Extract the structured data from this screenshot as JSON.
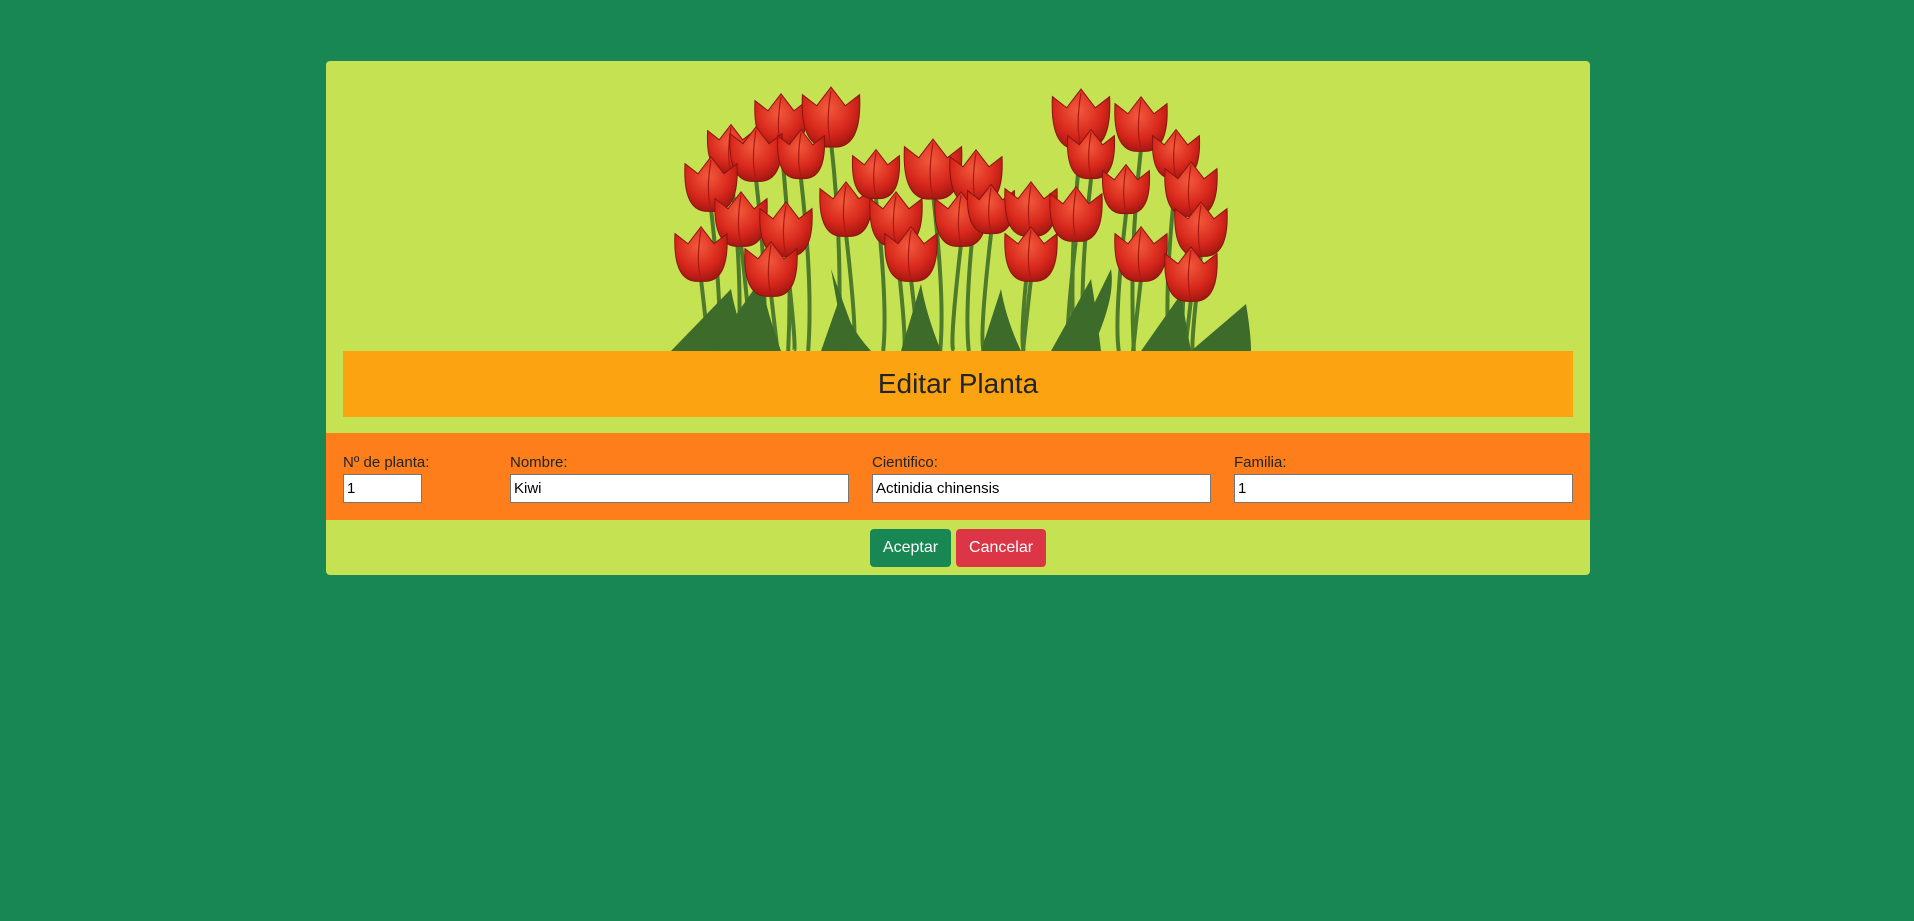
{
  "page": {
    "background_color": "#198754"
  },
  "card": {
    "background_color": "#c5e253",
    "banner_image": "tulips-image",
    "title": "Editar Planta",
    "title_bar_color": "#fca311",
    "form_band_color": "#fd7e1a"
  },
  "form": {
    "fields": [
      {
        "label": "Nº de planta:",
        "value": "1"
      },
      {
        "label": "Nombre:",
        "value": "Kiwi"
      },
      {
        "label": "Cientifico:",
        "value": "Actinidia chinensis"
      },
      {
        "label": "Familia:",
        "value": "1"
      }
    ]
  },
  "actions": {
    "accept_label": "Aceptar",
    "accept_color": "#198754",
    "cancel_label": "Cancelar",
    "cancel_color": "#dc3545"
  }
}
